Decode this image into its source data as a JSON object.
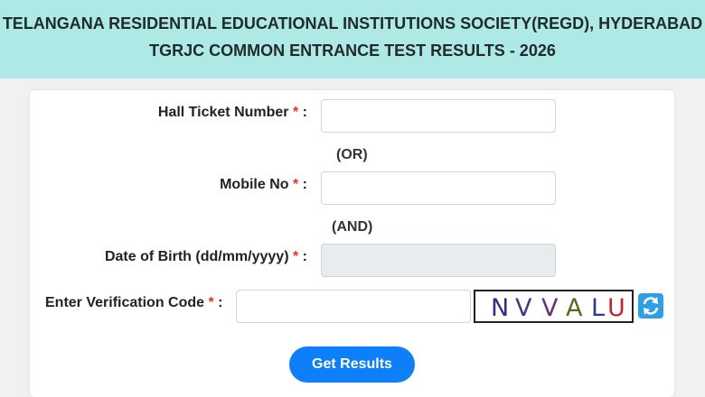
{
  "header": {
    "line1": "TELANGANA RESIDENTIAL EDUCATIONAL INSTITUTIONS SOCIETY(REGD), HYDERABAD",
    "line2": "TGRJC COMMON ENTRANCE TEST RESULTS - 2026"
  },
  "form": {
    "hall_ticket": {
      "label": "Hall Ticket Number",
      "required": "*",
      "colon": " :",
      "value": ""
    },
    "or_text": "(OR)",
    "mobile": {
      "label": "Mobile No",
      "required": "*",
      "colon": " :",
      "value": ""
    },
    "and_text": "(AND)",
    "dob": {
      "label": "Date of Birth (dd/mm/yyyy)",
      "required": "*",
      "colon": " :",
      "value": ""
    },
    "verification": {
      "label": "Enter Verification Code",
      "required": "*",
      "colon": " :",
      "value": ""
    },
    "captcha": {
      "c1": "N",
      "c2": "V",
      "c3": "V",
      "c4": "A",
      "c5": "L",
      "c6": "U"
    },
    "refresh_icon": "refresh-icon",
    "submit_label": "Get Results"
  },
  "colors": {
    "header_bg": "#aee9e5",
    "required": "#e0342c",
    "button": "#0d7ff8",
    "disabled_input": "#e9ecef"
  }
}
